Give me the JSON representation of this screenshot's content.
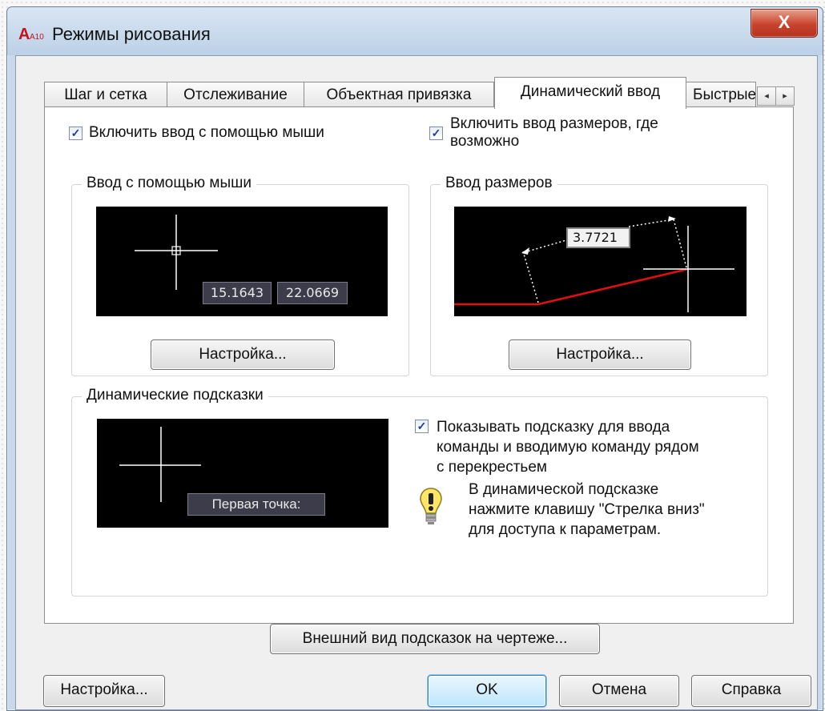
{
  "window": {
    "title": "Режимы рисования",
    "close_label": "X",
    "app_icon_label": "A10"
  },
  "tabs": [
    {
      "label": "Шаг и сетка"
    },
    {
      "label": "Отслеживание"
    },
    {
      "label": "Объектная привязка"
    },
    {
      "label": "Динамический ввод",
      "active": true
    },
    {
      "label": "Быстрые"
    }
  ],
  "tab_scroll": {
    "left": "◂",
    "right": "▸"
  },
  "checkboxes": {
    "mouse_input": {
      "label": "Включить ввод с помощью мыши",
      "checked": true
    },
    "dimension_input": {
      "label_line1": "Включить ввод размеров, где",
      "label_line2": "возможно",
      "checked": true
    },
    "show_prompts": {
      "label_line1": "Показывать подсказку для ввода",
      "label_line2": "команды и вводимую команду рядом",
      "label_line3": "с перекрестьем",
      "checked": true
    }
  },
  "groups": {
    "mouse_input": {
      "title": "Ввод с помощью мыши",
      "coord_x": "15.1643",
      "coord_y": "22.0669",
      "settings_button": "Настройка..."
    },
    "dimension_input": {
      "title": "Ввод размеров",
      "dimension_value": "3.7721",
      "settings_button": "Настройка..."
    },
    "dynamic_prompts": {
      "title": "Динамические подсказки",
      "prompt_text": "Первая точка:",
      "hint_line1": "В динамической подсказке",
      "hint_line2": "нажмите клавишу \"Стрелка вниз\"",
      "hint_line3": "для доступа к параметрам."
    }
  },
  "appearance_button": "Внешний вид подсказок на чертеже...",
  "footer": {
    "settings": "Настройка...",
    "ok": "OK",
    "cancel": "Отмена",
    "help": "Справка"
  },
  "colors": {
    "preview_bg": "#000000",
    "dimension_line": "#e01010",
    "close_button": "#c8432c"
  }
}
